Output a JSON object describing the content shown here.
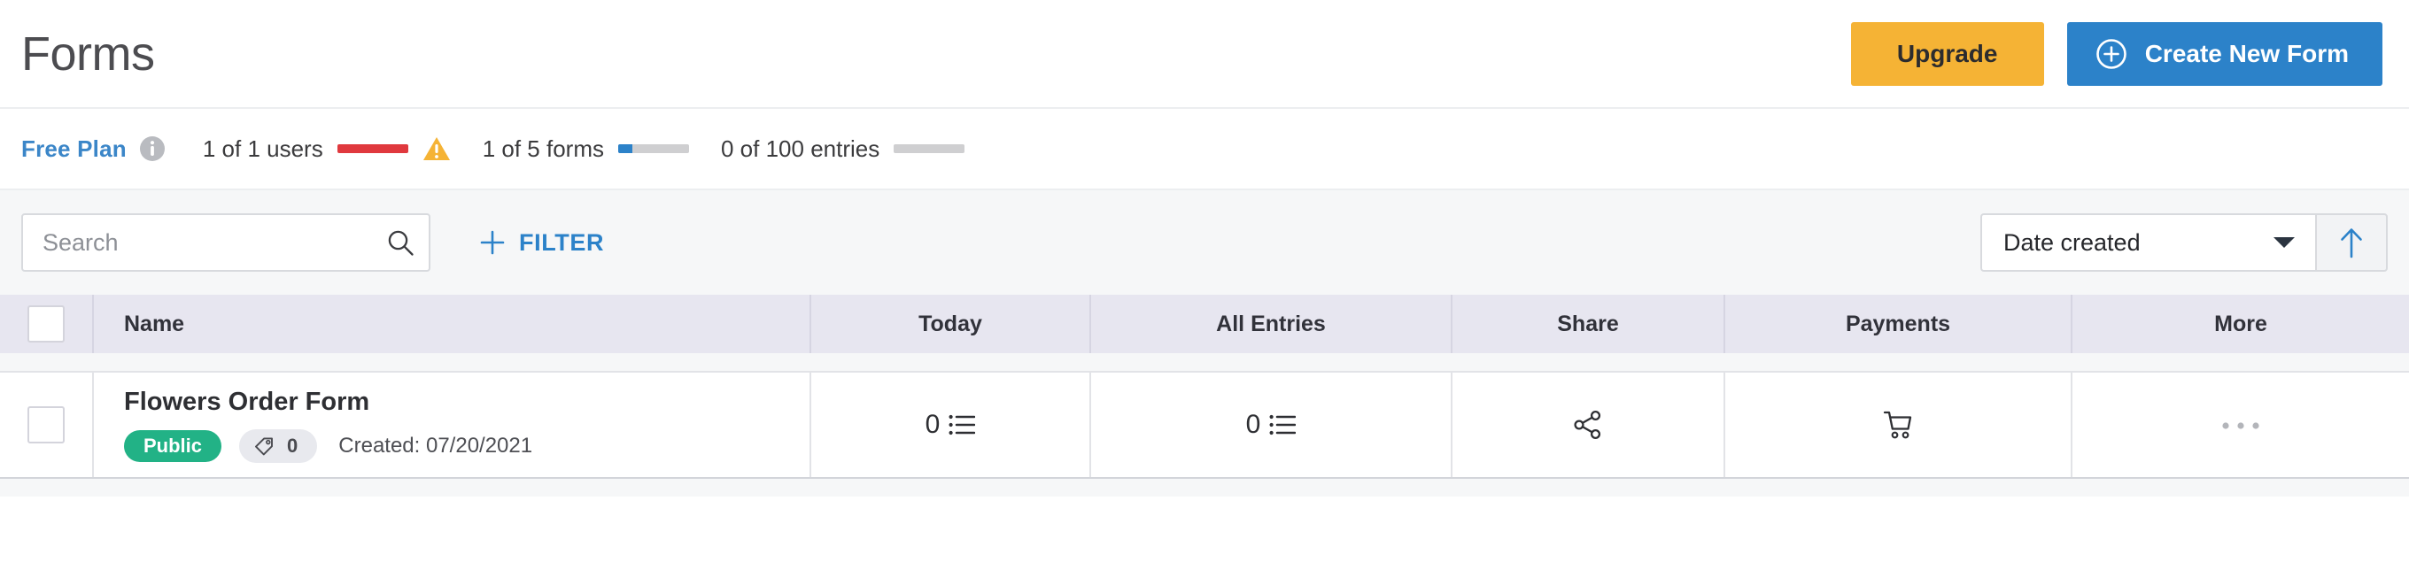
{
  "header": {
    "title": "Forms",
    "upgrade_label": "Upgrade",
    "create_label": "Create New Form",
    "upgrade_color": "#f5b335",
    "create_color": "#2c82c9"
  },
  "plan_bar": {
    "plan_name": "Free Plan",
    "plan_name_color": "#3b86c8",
    "info_icon": "info-circle-icon",
    "usage": [
      {
        "label": "1 of 1 users",
        "percent": 100,
        "bar_color": "#e0393e",
        "warning": true
      },
      {
        "label": "1 of 5 forms",
        "percent": 20,
        "bar_color": "#2c82c9",
        "warning": false
      },
      {
        "label": "0 of 100 entries",
        "percent": 0,
        "bar_color": "#cfcfd1",
        "warning": false
      }
    ]
  },
  "toolbar": {
    "search_placeholder": "Search",
    "search_value": "",
    "search_icon": "search-icon",
    "filter_label": "FILTER",
    "filter_icon": "plus-icon",
    "sort_value": "Date created",
    "sort_caret_icon": "chevron-down-icon",
    "sort_direction_icon": "arrow-up-icon",
    "sort_direction_color": "#2c82c9"
  },
  "table": {
    "columns": [
      {
        "key": "checkbox",
        "label": ""
      },
      {
        "key": "name",
        "label": "Name"
      },
      {
        "key": "today",
        "label": "Today"
      },
      {
        "key": "all_entries",
        "label": "All Entries"
      },
      {
        "key": "share",
        "label": "Share"
      },
      {
        "key": "payments",
        "label": "Payments"
      },
      {
        "key": "more",
        "label": "More"
      }
    ],
    "select_all_checked": false,
    "rows": [
      {
        "checked": false,
        "name": "Flowers Order Form",
        "status_badge": "Public",
        "status_color": "#22b286",
        "tag_count": "0",
        "tag_icon": "tag-icon",
        "created": "Created: 07/20/2021",
        "today": "0",
        "today_icon": "list-icon",
        "all_entries": "0",
        "all_entries_icon": "list-icon",
        "share_icon": "share-nodes-icon",
        "payments_icon": "shopping-cart-icon",
        "more_icon": "ellipsis-icon"
      }
    ]
  }
}
